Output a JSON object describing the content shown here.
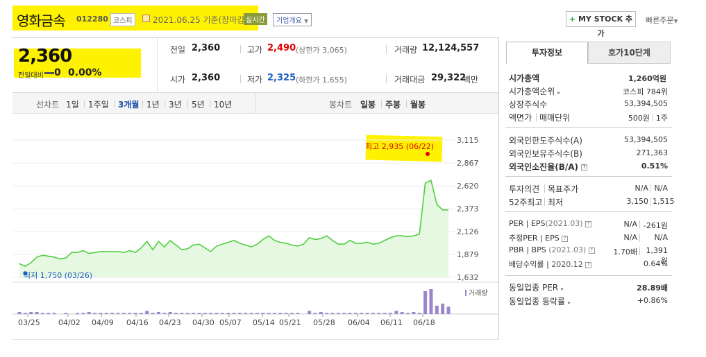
{
  "header": {
    "stock_name": "영화금속",
    "code": "012280",
    "market": "코스피",
    "date": "2021.06.25 기준(장마감)",
    "realtime_badge": "실시간",
    "company_overview": "기업개요",
    "mystock_plus": "+",
    "mystock_label": "MY STOCK 추가",
    "quick_order": "빠른주문"
  },
  "price": {
    "current": "2,360",
    "change_label": "전일대비",
    "change_value": "0",
    "change_pct": "0.00%"
  },
  "quote": {
    "prev_label": "전일",
    "prev": "2,360",
    "high_label": "고가",
    "high": "2,490",
    "upper_limit": "(상한가 3,065)",
    "volume_label": "거래량",
    "volume": "12,124,557",
    "open_label": "시가",
    "open": "2,360",
    "low_label": "저가",
    "low": "2,325",
    "lower_limit": "(하한가 1,655)",
    "amount_label": "거래대금",
    "amount": "29,322",
    "amount_unit": "백만"
  },
  "period_bar": {
    "line_chart": "선차트",
    "periods": [
      "1일",
      "1주일",
      "3개월",
      "1년",
      "3년",
      "5년",
      "10년"
    ],
    "selected": "3개월",
    "candle_chart": "봉차트",
    "candles": [
      "일봉",
      "주봉",
      "월봉"
    ]
  },
  "colors": {
    "up": "#e00000",
    "down": "#1a5fc0",
    "line": "#4fcf3f",
    "area": "#e6f8e2",
    "volume": "#9b86c9"
  },
  "chart_data": {
    "type": "area",
    "title": "",
    "price_ticks": [
      3115,
      2867,
      2620,
      2373,
      2126,
      1879,
      1632
    ],
    "ylim": [
      1632,
      3115
    ],
    "x_tick_labels": [
      "03/25",
      "04/02",
      "04/09",
      "04/16",
      "04/23",
      "04/30",
      "05/07",
      "05/14",
      "05/21",
      "05/28",
      "06/04",
      "06/11",
      "06/18"
    ],
    "max_annotation": "최고 2,935 (06/22)",
    "min_annotation": "최저 1,750 (03/26)",
    "volume_label": "거래량",
    "prices": [
      1780,
      1750,
      1790,
      1850,
      1870,
      1860,
      1850,
      1830,
      1840,
      1900,
      1900,
      1920,
      1890,
      1900,
      1910,
      1910,
      1910,
      1910,
      1900,
      1920,
      1900,
      1950,
      2020,
      1930,
      2020,
      1960,
      2030,
      1980,
      1930,
      1940,
      1980,
      1990,
      1950,
      1910,
      1970,
      1990,
      2010,
      2030,
      2000,
      1980,
      1960,
      1990,
      2040,
      2080,
      2030,
      2010,
      2000,
      1980,
      1970,
      1990,
      2060,
      2040,
      2050,
      2080,
      2030,
      1990,
      1990,
      2030,
      2000,
      2000,
      2010,
      1990,
      2000,
      2030,
      2060,
      2080,
      2080,
      2070,
      2080,
      2100,
      2650,
      2680,
      2420,
      2360,
      2360
    ],
    "volumes": [
      2,
      1,
      2,
      2,
      1,
      1,
      1,
      0,
      1,
      0,
      1,
      1,
      2,
      1,
      1,
      1,
      1,
      1,
      1,
      1,
      1,
      1,
      3,
      1,
      2,
      1,
      2,
      1,
      1,
      1,
      1,
      1,
      1,
      1,
      1,
      1,
      1,
      1,
      1,
      1,
      1,
      1,
      1,
      1,
      1,
      1,
      1,
      1,
      1,
      0,
      3,
      1,
      2,
      1,
      1,
      1,
      1,
      1,
      1,
      1,
      1,
      1,
      1,
      1,
      1,
      3,
      2,
      1,
      2,
      1,
      22,
      24,
      8,
      10,
      7
    ]
  },
  "right_panel": {
    "tabs": [
      "투자정보",
      "호가10단계"
    ],
    "market_cap_label": "시가총액",
    "market_cap": "1,260억원",
    "market_cap_rank_label": "시가총액순위",
    "market_cap_rank": "코스피 784위",
    "shares_label": "상장주식수",
    "shares": "53,394,505",
    "par_label": "액면가",
    "trade_unit_label": "매매단위",
    "par": "500원",
    "trade_unit": "1주",
    "foreign_limit_label": "외국인한도주식수(A)",
    "foreign_limit": "53,394,505",
    "foreign_hold_label": "외국인보유주식수(B)",
    "foreign_hold": "271,363",
    "foreign_ratio_label": "외국인소진율(B/A)",
    "foreign_ratio": "0.51%",
    "opinion_label": "투자의견",
    "target_label": "목표주가",
    "opinion": "N/A",
    "target": "N/A",
    "w52_high_label": "52주최고",
    "w52_low_label": "최저",
    "w52_high": "3,150",
    "w52_low": "1,515",
    "per_label": "PER",
    "eps_label": "EPS",
    "per_period": "(2021.03)",
    "per": "N/A",
    "eps": "-261원",
    "est_per_label": "추정PER",
    "est_eps_label": "EPS",
    "est_per": "N/A",
    "est_eps": "N/A",
    "pbr_label": "PBR",
    "bps_label": "BPS",
    "bps_period": "(2021.03)",
    "pbr": "1.70배",
    "bps": "1,391원",
    "div_label": "배당수익률",
    "div_period": "2020.12",
    "div": "0.64%",
    "sector_per_label": "동일업종 PER",
    "sector_per": "28.89배",
    "sector_chg_label": "동일업종 등락률",
    "sector_chg": "+0.86%"
  }
}
